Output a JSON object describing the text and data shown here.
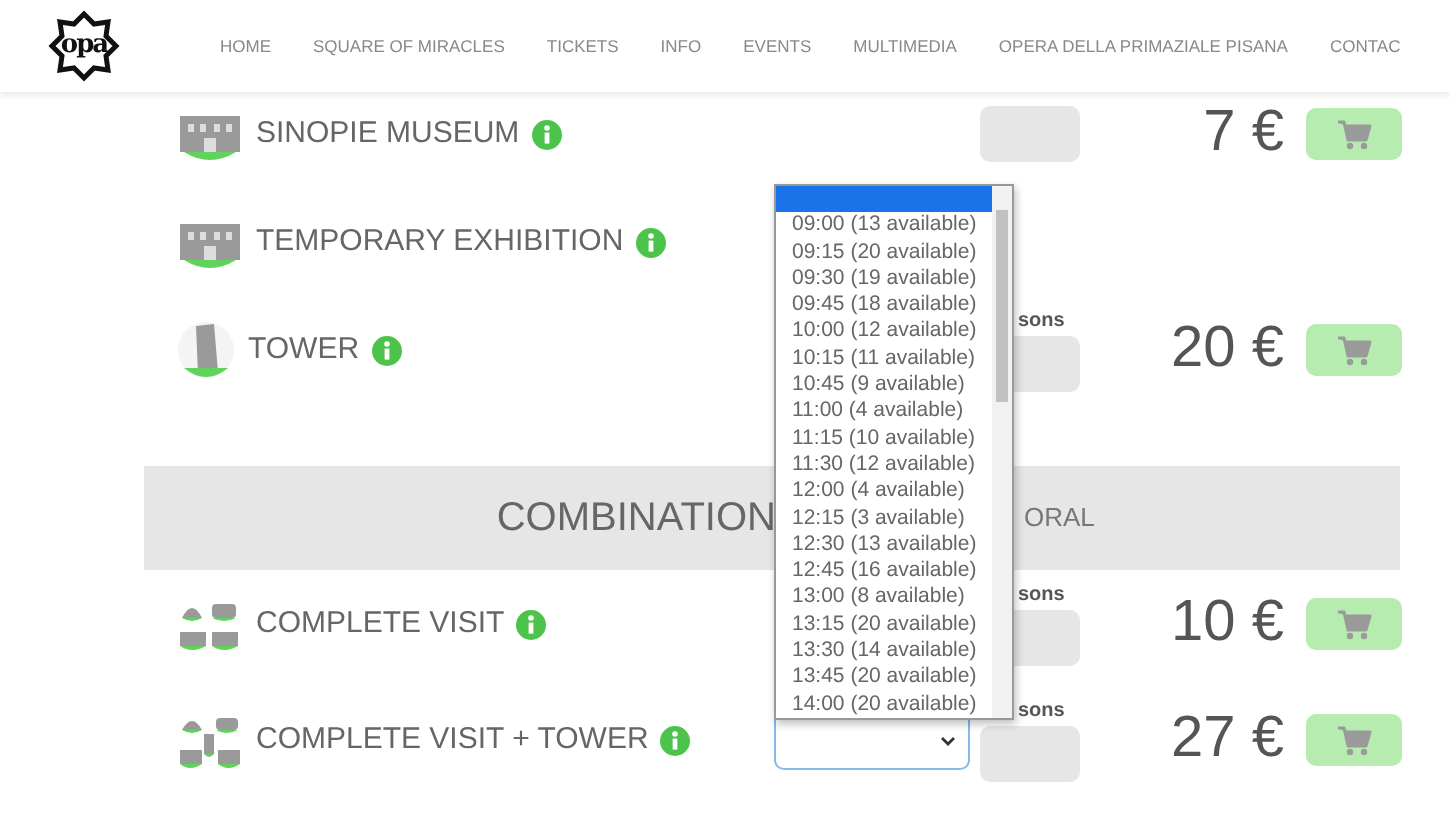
{
  "navbar": {
    "logo": "opa",
    "items": [
      {
        "label": "HOME"
      },
      {
        "label": "SQUARE OF MIRACLES"
      },
      {
        "label": "TICKETS"
      },
      {
        "label": "INFO"
      },
      {
        "label": "EVENTS"
      },
      {
        "label": "MULTIMEDIA"
      },
      {
        "label": "OPERA DELLA PRIMAZIALE PISANA"
      },
      {
        "label": "CONTAC"
      }
    ]
  },
  "rows": [
    {
      "kind": "ticket",
      "name": "SINOPIE MUSEUM",
      "persons_field": true,
      "price": "7 €",
      "cart": true
    },
    {
      "kind": "ticket",
      "name": "TEMPORARY EXHIBITION",
      "persons_field": false,
      "cart": false
    },
    {
      "kind": "ticket",
      "name": "TOWER",
      "persons_label": "sons",
      "persons_field": true,
      "price": "20 €",
      "cart": true
    },
    {
      "kind": "band",
      "left": "COMBINATION",
      "right": "ORAL"
    },
    {
      "kind": "ticket",
      "name": "COMPLETE VISIT",
      "persons_label": "sons",
      "persons_field": true,
      "price": "10 €",
      "cart": true
    },
    {
      "kind": "ticket",
      "name": "COMPLETE VISIT + TOWER",
      "time_select": true,
      "persons_label": "sons",
      "persons_field": true,
      "price": "27 €",
      "cart": true
    }
  ],
  "dropdown": {
    "blank_option_selected": true,
    "options": [
      {
        "label": "09:00 (13 available)",
        "selected": false
      },
      {
        "label": "09:15 (20 available)",
        "selected": false
      },
      {
        "label": "09:30 (19 available)",
        "selected": false
      },
      {
        "label": "09:45 (18 available)",
        "selected": false
      },
      {
        "label": "10:00 (12 available)",
        "selected": false
      },
      {
        "label": "10:15 (11 available)",
        "selected": false
      },
      {
        "label": "10:45 (9 available)",
        "selected": false
      },
      {
        "label": "11:00 (4 available)",
        "selected": false
      },
      {
        "label": "11:15 (10 available)",
        "selected": false
      },
      {
        "label": "11:30 (12 available)",
        "selected": false
      },
      {
        "label": "12:00 (4 available)",
        "selected": false
      },
      {
        "label": "12:15 (3 available)",
        "selected": false
      },
      {
        "label": "12:30 (13 available)",
        "selected": false
      },
      {
        "label": "12:45 (16 available)",
        "selected": false
      },
      {
        "label": "13:00 (8 available)",
        "selected": false
      },
      {
        "label": "13:15 (20 available)",
        "selected": false
      },
      {
        "label": "13:30 (14 available)",
        "selected": false
      },
      {
        "label": "13:45 (20 available)",
        "selected": false
      },
      {
        "label": "14:00 (20 available)",
        "selected": false
      }
    ]
  }
}
